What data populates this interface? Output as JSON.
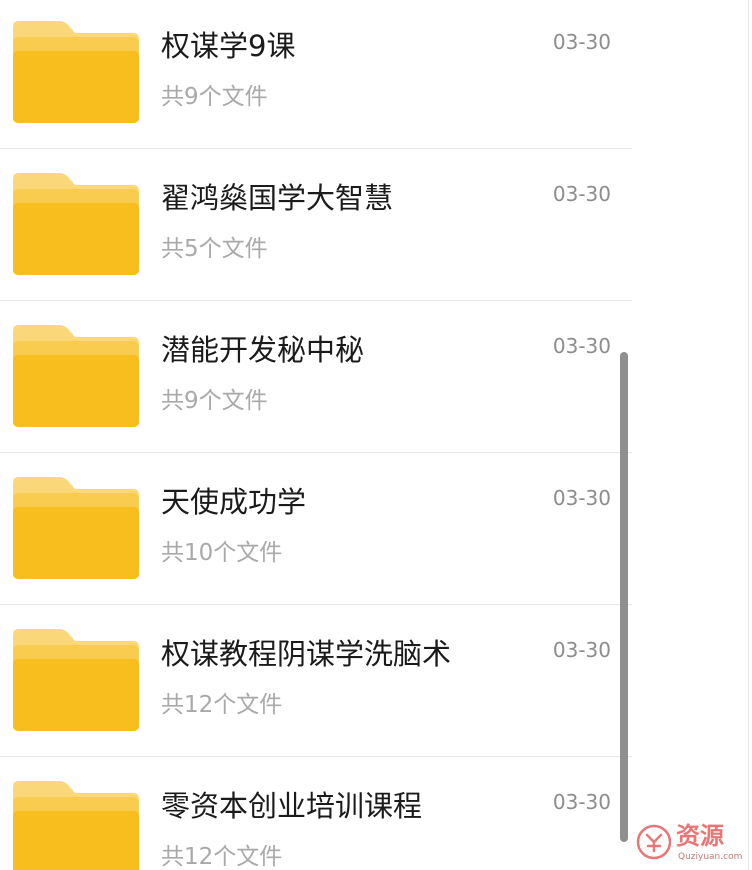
{
  "colors": {
    "folder_back": "#F9CB4F",
    "folder_front": "#F7BE1E",
    "folder_tab": "#FAD87A",
    "title_text": "#1B1B1B",
    "subtitle_text": "#A9A9A9",
    "date_text": "#8C8C8C",
    "divider": "#E8E8E8",
    "scrollbar": "#8F8F8F",
    "watermark": "#E04A4A"
  },
  "icons": {
    "folder": "folder-icon"
  },
  "files": [
    {
      "name": "权谋学9课",
      "count": "共9个文件",
      "date": "03-30"
    },
    {
      "name": "翟鸿燊国学大智慧",
      "count": "共5个文件",
      "date": "03-30"
    },
    {
      "name": "潜能开发秘中秘",
      "count": "共9个文件",
      "date": "03-30"
    },
    {
      "name": "天使成功学",
      "count": "共10个文件",
      "date": "03-30"
    },
    {
      "name": "权谋教程阴谋学洗脑术",
      "count": "共12个文件",
      "date": "03-30"
    },
    {
      "name": "零资本创业培训课程",
      "count": "共12个文件",
      "date": "03-30"
    }
  ],
  "watermark": {
    "name": "资源",
    "domain": "Quziyuan.com"
  }
}
